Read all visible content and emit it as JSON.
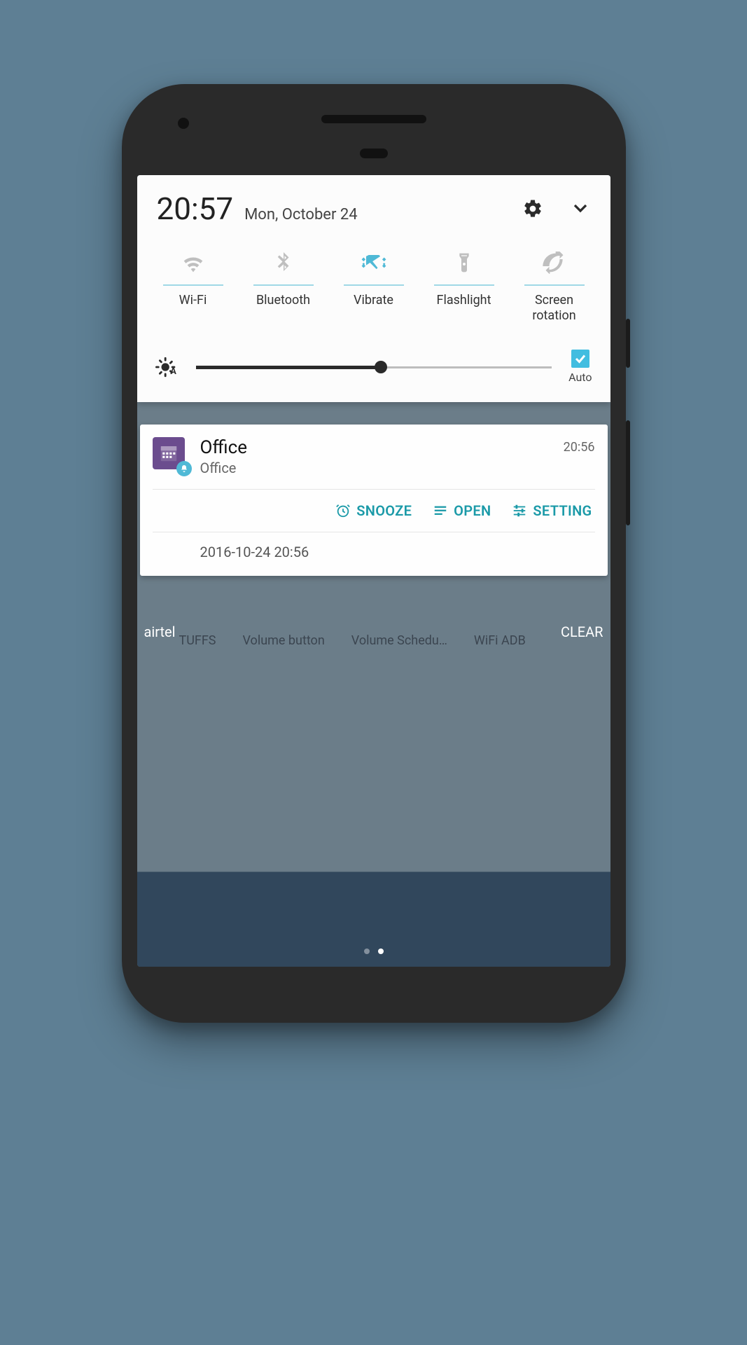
{
  "header": {
    "time": "20:57",
    "date": "Mon, October 24"
  },
  "tiles": [
    {
      "label": "Wi-Fi",
      "active": false
    },
    {
      "label": "Bluetooth",
      "active": false
    },
    {
      "label": "Vibrate",
      "active": true
    },
    {
      "label": "Flashlight",
      "active": false
    },
    {
      "label": "Screen rotation",
      "active": false
    }
  ],
  "brightness": {
    "percent": 52,
    "auto_label": "Auto",
    "auto_checked": true
  },
  "notification": {
    "title": "Office",
    "subtitle": "Office",
    "time": "20:56",
    "actions": {
      "snooze": "SNOOZE",
      "open": "OPEN",
      "setting": "SETTING"
    },
    "timestamp": "2016-10-24 20:56"
  },
  "background": {
    "carrier": "airtel",
    "clear": "CLEAR",
    "apps": [
      "TUFFS",
      "Volume button",
      "Volume Schedu…",
      "WiFi ADB"
    ]
  }
}
